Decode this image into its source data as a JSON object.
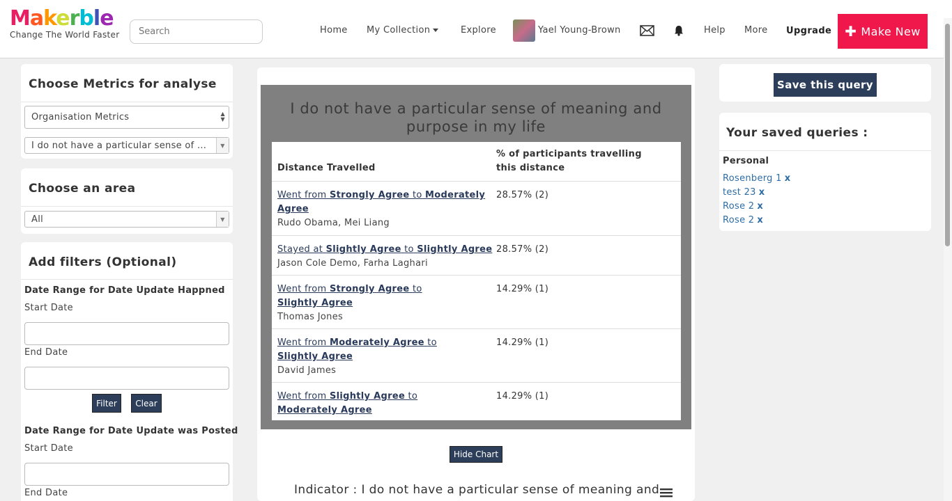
{
  "header": {
    "logo_text": "Makerble",
    "logo_tagline": "Change The World Faster",
    "search_placeholder": "Search",
    "nav": {
      "home": "Home",
      "my_collection": "My Collection",
      "explore": "Explore",
      "user_name": "Yael Young-Brown",
      "help": "Help",
      "more": "More",
      "upgrade": "Upgrade",
      "make_new": "Make New"
    }
  },
  "left": {
    "metrics": {
      "title": "Choose Metrics for analyse",
      "metric_type": "Organisation Metrics",
      "metric_value": "I do not have a particular sense of ..."
    },
    "area": {
      "title": "Choose an area",
      "value": "All"
    },
    "filters": {
      "title": "Add filters (Optional)",
      "group1_label": "Date Range for Date Update Happned",
      "group2_label": "Date Range for Date Update was Posted",
      "start_date": "Start Date",
      "end_date": "End Date",
      "filter_btn": "Filter",
      "clear_btn": "Clear"
    }
  },
  "center": {
    "chart_title": "I do not have a particular sense of meaning and purpose in my life",
    "columns": [
      "Distance Travelled",
      "% of participants travelling this distance"
    ],
    "rows": [
      {
        "verb": "Went from",
        "from": "Strongly Agree",
        "to": "Moderately Agree",
        "people": "Rudo Obama, Mei Liang",
        "value": "28.57% (2)"
      },
      {
        "verb": "Stayed at",
        "from": "Slightly Agree",
        "to": "Slightly Agree",
        "people": "Jason Cole Demo, Farha Laghari",
        "value": "28.57% (2)"
      },
      {
        "verb": "Went from",
        "from": "Strongly Agree",
        "to": "Slightly Agree",
        "people": "Thomas Jones",
        "value": "14.29% (1)"
      },
      {
        "verb": "Went from",
        "from": "Moderately Agree",
        "to": "Slightly Agree",
        "people": "David James",
        "value": "14.29% (1)"
      },
      {
        "verb": "Went from",
        "from": "Slightly Agree",
        "to": "Moderately Agree",
        "people": "",
        "value": "14.29% (1)"
      }
    ],
    "to_word": "to",
    "hide_chart": "Hide Chart",
    "indicator": "Indicator : I do not have a particular sense of meaning and"
  },
  "right": {
    "save_query": "Save this query",
    "saved_title": "Your saved queries :",
    "personal_label": "Personal",
    "queries": [
      "Rosenberg 1",
      "test 23",
      "Rose 2",
      "Rose 2"
    ],
    "remove_mark": "x"
  },
  "colors": {
    "brand_red": "#f0174b",
    "navy_button": "#2c3e5a",
    "link_blue": "#2e6da4"
  }
}
